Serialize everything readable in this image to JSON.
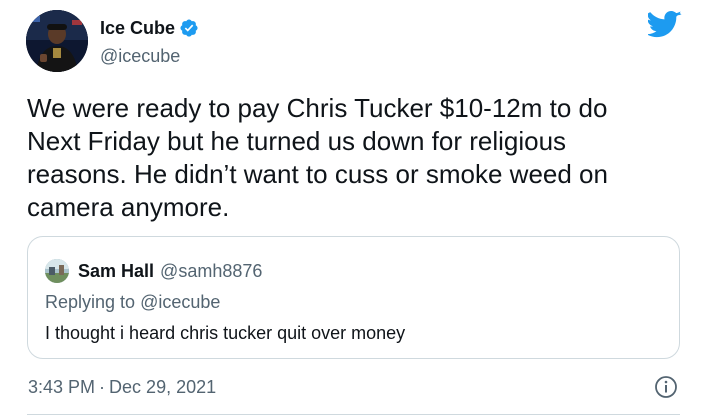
{
  "author": {
    "display_name": "Ice Cube",
    "handle": "@icecube",
    "verified": true,
    "avatar_icon": "profile-photo"
  },
  "tweet": {
    "text": "We were ready to pay Chris Tucker $10-12m to do Next Friday but he turned us down for religious reasons. He didn’t want to cuss or smoke weed on camera anymore.",
    "time": "3:43 PM",
    "separator": "·",
    "date": "Dec 29, 2021"
  },
  "quoted_tweet": {
    "display_name": "Sam Hall",
    "handle": "@samh8876",
    "replying_prefix": "Replying to",
    "replying_to": "@icecube",
    "text": "I thought i heard chris tucker quit over money"
  },
  "icons": {
    "brand": "twitter-bird-icon",
    "verified": "verified-badge-icon",
    "info": "info-icon"
  },
  "colors": {
    "brand_blue": "#1d9bf0",
    "text_primary": "#0f1419",
    "text_secondary": "#536471",
    "border": "#cfd9de"
  }
}
